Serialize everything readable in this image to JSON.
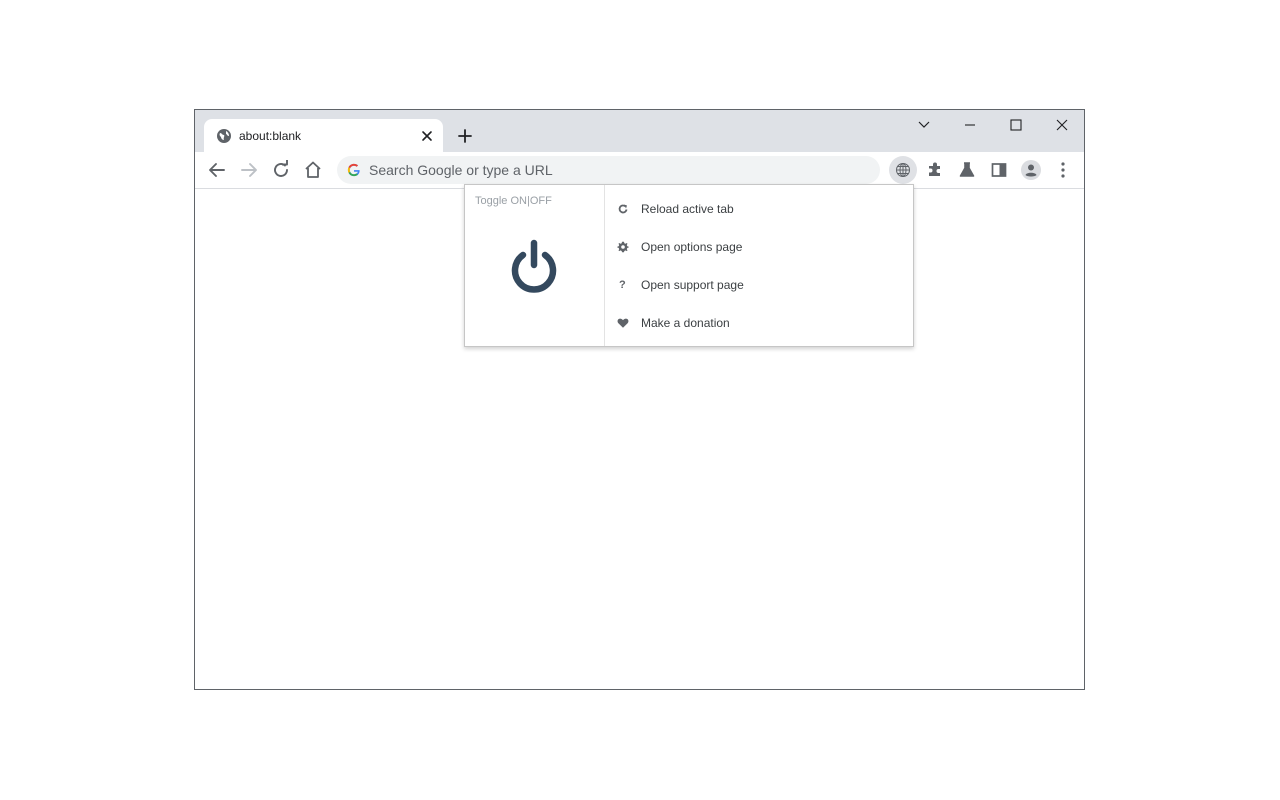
{
  "tab": {
    "title": "about:blank"
  },
  "omnibox": {
    "placeholder": "Search Google or type a URL"
  },
  "popup": {
    "toggle_label": "Toggle ON|OFF",
    "menu": [
      {
        "label": "Reload active tab",
        "icon": "reload-icon"
      },
      {
        "label": "Open options page",
        "icon": "gear-icon"
      },
      {
        "label": "Open support page",
        "icon": "question-icon",
        "glyph": "?"
      },
      {
        "label": "Make a donation",
        "icon": "heart-icon"
      }
    ]
  },
  "colors": {
    "power": "#34495e",
    "tabstrip": "#dee1e6",
    "omnibox": "#f1f3f4"
  }
}
